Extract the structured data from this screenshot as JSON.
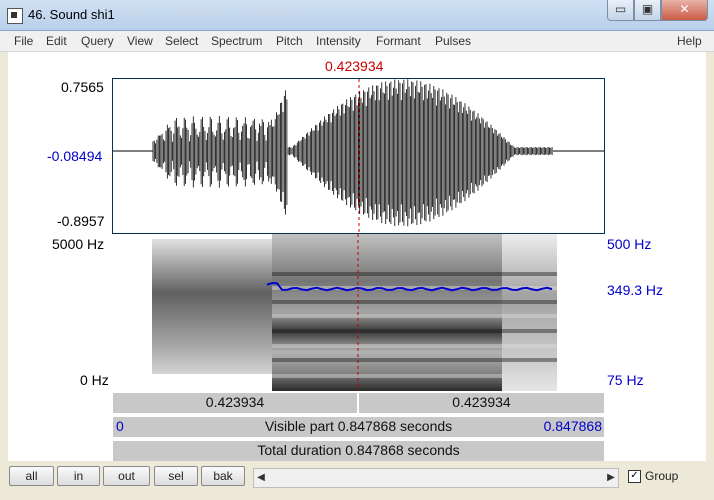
{
  "window": {
    "title": "46. Sound shi1",
    "controls": {
      "minimize": "▭",
      "maximize": "▣",
      "close": "✕"
    }
  },
  "menu": [
    "File",
    "Edit",
    "Query",
    "View",
    "Select",
    "Spectrum",
    "Pitch",
    "Intensity",
    "Formant",
    "Pulses"
  ],
  "help_label": "Help",
  "cursor_time": "0.423934",
  "wave_labels": {
    "max": "0.7565",
    "zero": "-0.08494",
    "min": "-0.8957"
  },
  "spec_labels": {
    "freq_max": "5000 Hz",
    "freq_min": "0 Hz",
    "pitch_max": "500 Hz",
    "pitch_value": "349.3 Hz",
    "pitch_min": "75 Hz"
  },
  "bars": {
    "left_time": "0.423934",
    "right_time": "0.423934",
    "visible_start": "0",
    "visible_label": "Visible part 0.847868 seconds",
    "visible_end": "0.847868",
    "total_label": "Total duration 0.847868 seconds"
  },
  "buttons": {
    "all": "all",
    "in": "in",
    "out": "out",
    "sel": "sel",
    "bak": "bak"
  },
  "group_label": "Group",
  "group_checked": true,
  "colors": {
    "waveform": "#000000",
    "pitch": "#0000cc",
    "cursor": "#cc0000"
  }
}
